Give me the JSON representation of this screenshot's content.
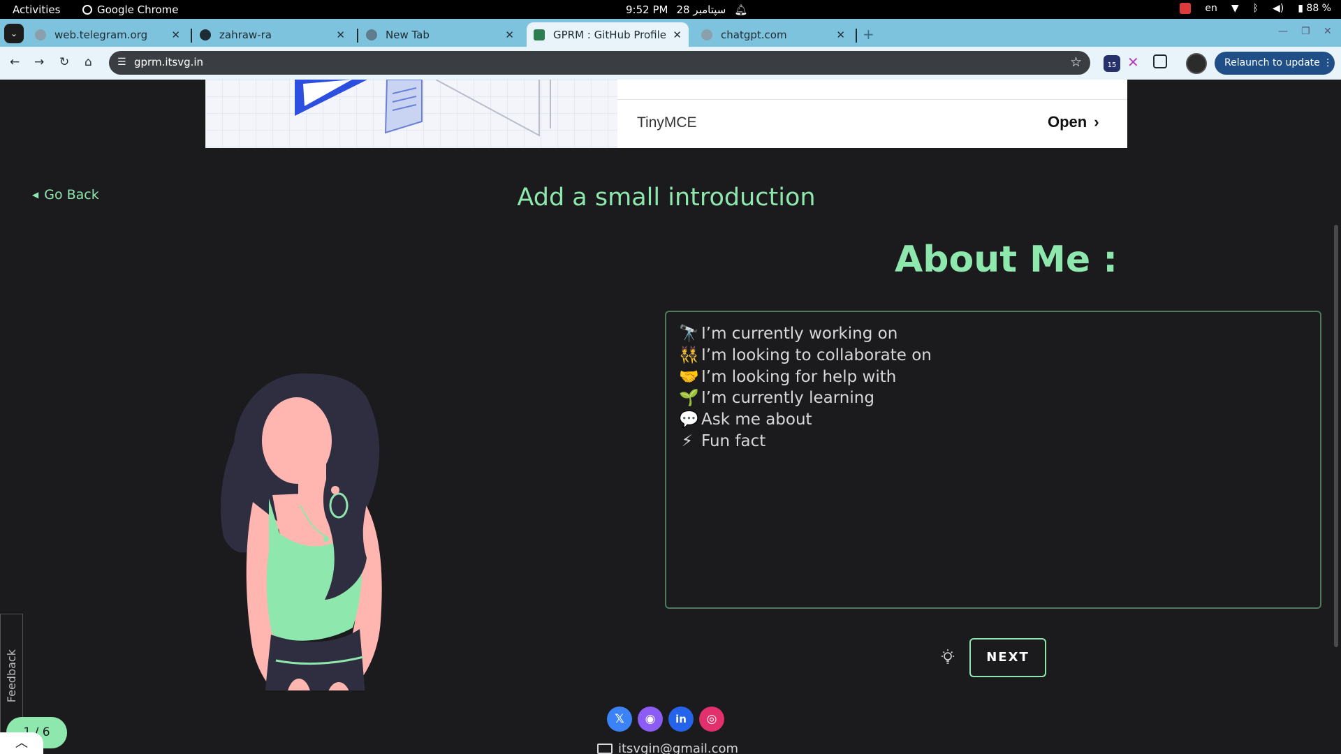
{
  "os": {
    "activities": "Activities",
    "app_name": "Google Chrome",
    "time": "9:52 PM",
    "date": "28 سپتامبر",
    "language": "en",
    "battery": "88 %"
  },
  "browser": {
    "tabs": [
      {
        "title": "web.telegram.org",
        "favicon": "globe-icon",
        "color": "#8aa0ad"
      },
      {
        "title": "zahraw-ra",
        "favicon": "github-icon",
        "color": "#1d2b33"
      },
      {
        "title": "New Tab",
        "favicon": "chrome-icon",
        "color": "#5f7d8c"
      },
      {
        "title": "GPRM : GitHub Profile R",
        "favicon": "gprm-icon",
        "color": "#2d7d52",
        "active": true
      },
      {
        "title": "chatgpt.com",
        "favicon": "globe-icon",
        "color": "#8aa0ad"
      }
    ],
    "url": "gprm.itsvg.in",
    "extension_badge": "15",
    "relaunch_label": "Relaunch to update"
  },
  "ad": {
    "brand": "TinyMCE",
    "open_label": "Open"
  },
  "page": {
    "go_back": "Go Back",
    "title": "Add a small introduction",
    "about_heading": "About Me :",
    "intro_lines": [
      {
        "emoji": "🔭",
        "text": "I’m currently working on"
      },
      {
        "emoji": "👯",
        "text": "I’m looking to collaborate on"
      },
      {
        "emoji": "🤝",
        "text": "I’m looking for help with"
      },
      {
        "emoji": "🌱",
        "text": "I’m currently learning"
      },
      {
        "emoji": "💬",
        "text": "Ask me about"
      },
      {
        "emoji": "⚡",
        "text": "Fun fact"
      }
    ],
    "next_label": "NEXT",
    "email": "itsvgin@gmail.com",
    "feedback": "Feedback",
    "progress": "1 / 6",
    "socials": [
      {
        "name": "x-icon",
        "glyph": "𝕏",
        "color": "#3b82f6"
      },
      {
        "name": "github-icon",
        "glyph": "◉",
        "color": "#8b5cf6"
      },
      {
        "name": "linkedin-icon",
        "glyph": "in",
        "color": "#2563eb"
      },
      {
        "name": "instagram-icon",
        "glyph": "◎",
        "color": "#e1306c"
      }
    ]
  },
  "colors": {
    "accent": "#8ee8ae",
    "background": "#1b1a1d",
    "chrome_frame": "#7ec3de"
  }
}
